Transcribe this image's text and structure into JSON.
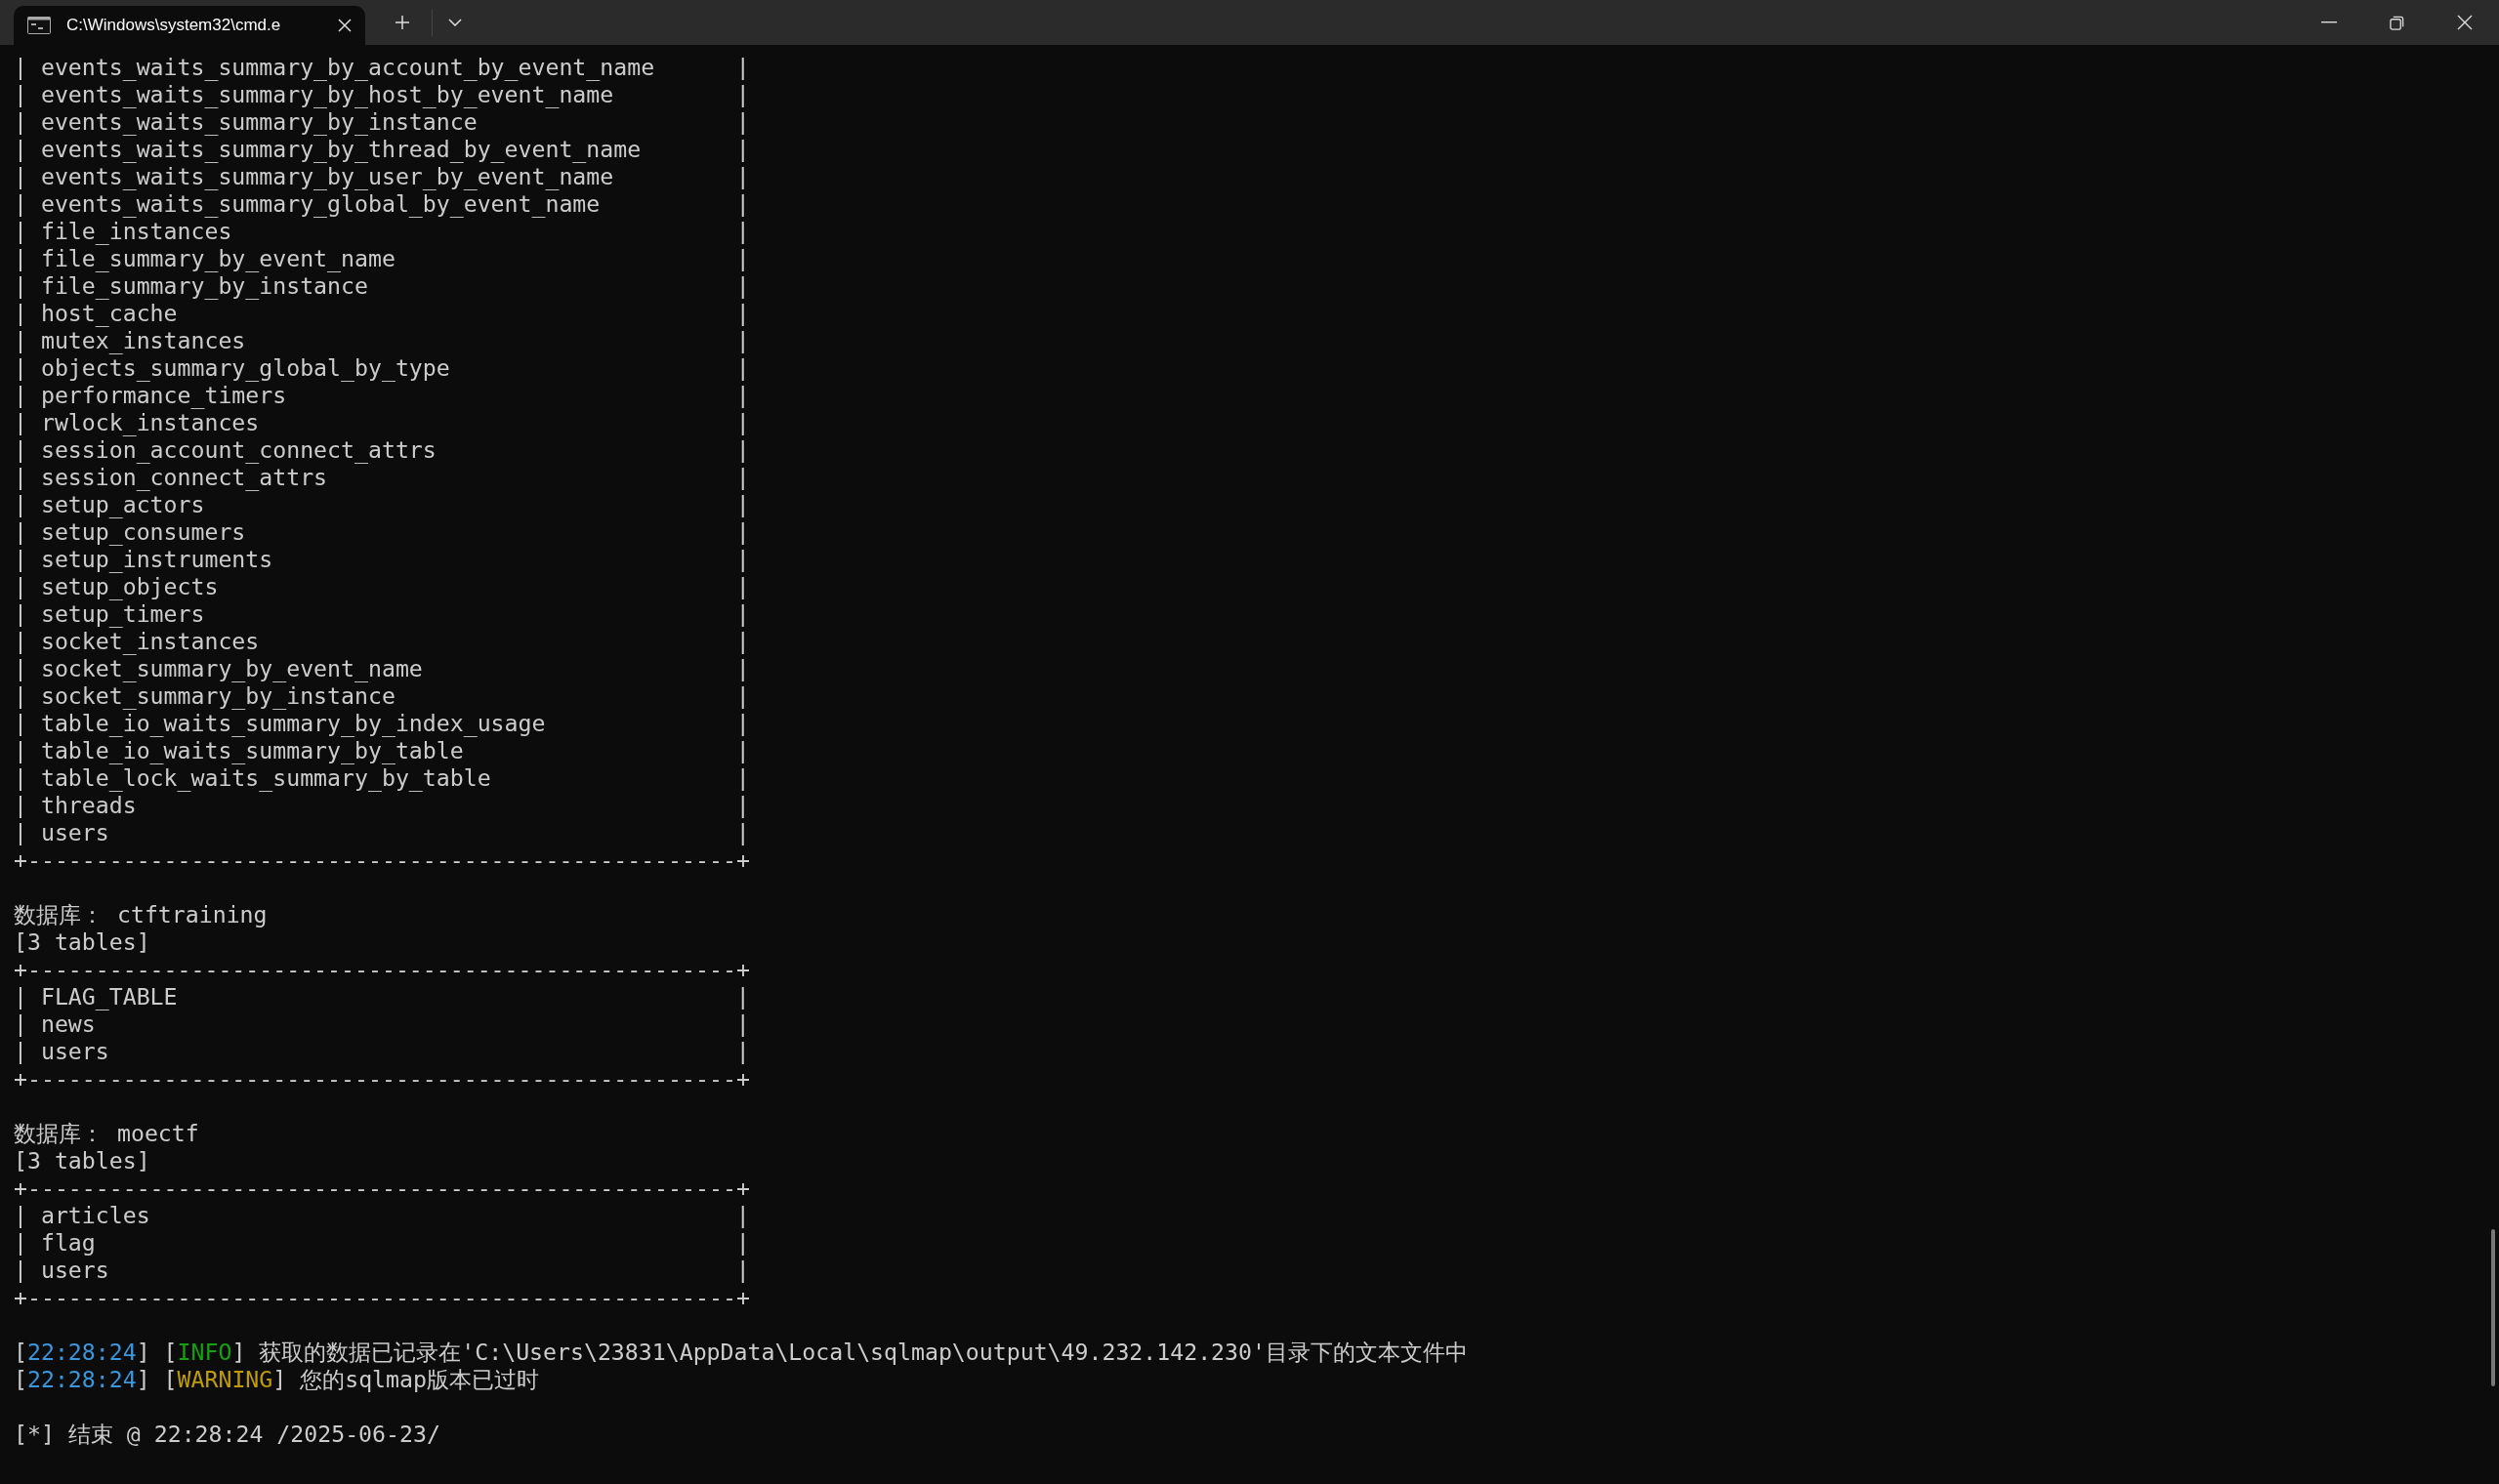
{
  "window": {
    "tab_title": "C:\\Windows\\system32\\cmd.e"
  },
  "terminal": {
    "lines": [
      {
        "kind": "row",
        "left": "|",
        "name": "events_waits_summary_by_account_by_event_name",
        "right": "|"
      },
      {
        "kind": "row",
        "left": "|",
        "name": "events_waits_summary_by_host_by_event_name",
        "right": "|"
      },
      {
        "kind": "row",
        "left": "|",
        "name": "events_waits_summary_by_instance",
        "right": "|"
      },
      {
        "kind": "row",
        "left": "|",
        "name": "events_waits_summary_by_thread_by_event_name",
        "right": "|"
      },
      {
        "kind": "row",
        "left": "|",
        "name": "events_waits_summary_by_user_by_event_name",
        "right": "|"
      },
      {
        "kind": "row",
        "left": "|",
        "name": "events_waits_summary_global_by_event_name",
        "right": "|"
      },
      {
        "kind": "row",
        "left": "|",
        "name": "file_instances",
        "right": "|"
      },
      {
        "kind": "row",
        "left": "|",
        "name": "file_summary_by_event_name",
        "right": "|"
      },
      {
        "kind": "row",
        "left": "|",
        "name": "file_summary_by_instance",
        "right": "|"
      },
      {
        "kind": "row",
        "left": "|",
        "name": "host_cache",
        "right": "|"
      },
      {
        "kind": "row",
        "left": "|",
        "name": "mutex_instances",
        "right": "|"
      },
      {
        "kind": "row",
        "left": "|",
        "name": "objects_summary_global_by_type",
        "right": "|"
      },
      {
        "kind": "row",
        "left": "|",
        "name": "performance_timers",
        "right": "|"
      },
      {
        "kind": "row",
        "left": "|",
        "name": "rwlock_instances",
        "right": "|"
      },
      {
        "kind": "row",
        "left": "|",
        "name": "session_account_connect_attrs",
        "right": "|"
      },
      {
        "kind": "row",
        "left": "|",
        "name": "session_connect_attrs",
        "right": "|"
      },
      {
        "kind": "row",
        "left": "|",
        "name": "setup_actors",
        "right": "|"
      },
      {
        "kind": "row",
        "left": "|",
        "name": "setup_consumers",
        "right": "|"
      },
      {
        "kind": "row",
        "left": "|",
        "name": "setup_instruments",
        "right": "|"
      },
      {
        "kind": "row",
        "left": "|",
        "name": "setup_objects",
        "right": "|"
      },
      {
        "kind": "row",
        "left": "|",
        "name": "setup_timers",
        "right": "|"
      },
      {
        "kind": "row",
        "left": "|",
        "name": "socket_instances",
        "right": "|"
      },
      {
        "kind": "row",
        "left": "|",
        "name": "socket_summary_by_event_name",
        "right": "|"
      },
      {
        "kind": "row",
        "left": "|",
        "name": "socket_summary_by_instance",
        "right": "|"
      },
      {
        "kind": "row",
        "left": "|",
        "name": "table_io_waits_summary_by_index_usage",
        "right": "|"
      },
      {
        "kind": "row",
        "left": "|",
        "name": "table_io_waits_summary_by_table",
        "right": "|"
      },
      {
        "kind": "row",
        "left": "|",
        "name": "table_lock_waits_summary_by_table",
        "right": "|"
      },
      {
        "kind": "row",
        "left": "|",
        "name": "threads",
        "right": "|"
      },
      {
        "kind": "row",
        "left": "|",
        "name": "users",
        "right": "|"
      },
      {
        "kind": "border",
        "text": "+----------------------------------------------------+"
      },
      {
        "kind": "blank"
      },
      {
        "kind": "text",
        "text": "数据库： ctftraining"
      },
      {
        "kind": "text",
        "text": "[3 tables]"
      },
      {
        "kind": "border",
        "text": "+----------------------------------------------------+"
      },
      {
        "kind": "row",
        "left": "|",
        "name": "FLAG_TABLE",
        "right": "|"
      },
      {
        "kind": "row",
        "left": "|",
        "name": "news",
        "right": "|"
      },
      {
        "kind": "row",
        "left": "|",
        "name": "users",
        "right": "|"
      },
      {
        "kind": "border",
        "text": "+----------------------------------------------------+"
      },
      {
        "kind": "blank"
      },
      {
        "kind": "text",
        "text": "数据库： moectf"
      },
      {
        "kind": "text",
        "text": "[3 tables]"
      },
      {
        "kind": "border",
        "text": "+----------------------------------------------------+"
      },
      {
        "kind": "row",
        "left": "|",
        "name": "articles",
        "right": "|"
      },
      {
        "kind": "row",
        "left": "|",
        "name": "flag",
        "right": "|"
      },
      {
        "kind": "row",
        "left": "|",
        "name": "users",
        "right": "|"
      },
      {
        "kind": "border",
        "text": "+----------------------------------------------------+"
      },
      {
        "kind": "blank"
      },
      {
        "kind": "log",
        "segments": [
          {
            "kind": "plain",
            "text": "["
          },
          {
            "kind": "time",
            "text": "22:28:24"
          },
          {
            "kind": "plain",
            "text": "] ["
          },
          {
            "kind": "info",
            "text": "INFO"
          },
          {
            "kind": "plain",
            "text": "] 获取的数据已记录在'C:\\Users\\23831\\AppData\\Local\\sqlmap\\output\\49.232.142.230'目录下的文本文件中"
          }
        ]
      },
      {
        "kind": "log",
        "segments": [
          {
            "kind": "plain",
            "text": "["
          },
          {
            "kind": "time",
            "text": "22:28:24"
          },
          {
            "kind": "plain",
            "text": "] ["
          },
          {
            "kind": "warning",
            "text": "WARNING"
          },
          {
            "kind": "plain",
            "text": "] 您的sqlmap版本已过时"
          }
        ]
      },
      {
        "kind": "blank"
      },
      {
        "kind": "text",
        "text": "[*] 结束 @ 22:28:24 /2025-06-23/"
      }
    ]
  }
}
